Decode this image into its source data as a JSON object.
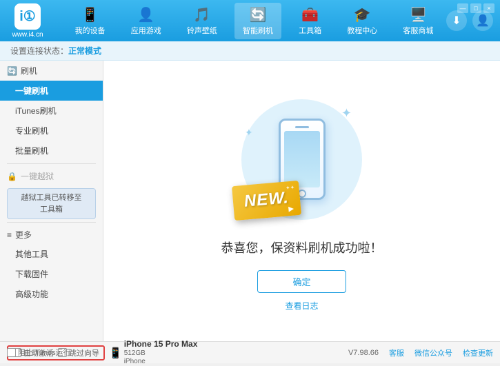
{
  "app": {
    "logo_text": "www.i4.cn",
    "logo_char": "i①"
  },
  "nav": {
    "items": [
      {
        "id": "my-devices",
        "label": "我的设备",
        "icon": "📱"
      },
      {
        "id": "apps-games",
        "label": "应用游戏",
        "icon": "👤"
      },
      {
        "id": "ringtones",
        "label": "铃声壁纸",
        "icon": "🎵"
      },
      {
        "id": "smart-flash",
        "label": "智能刷机",
        "icon": "🔄",
        "active": true
      },
      {
        "id": "toolbox",
        "label": "工具箱",
        "icon": "🧰"
      },
      {
        "id": "tutorials",
        "label": "教程中心",
        "icon": "🎓"
      },
      {
        "id": "service",
        "label": "客服商城",
        "icon": "🖥️"
      }
    ]
  },
  "statusbar": {
    "prefix": "设置连接状态：",
    "status": "正常模式"
  },
  "sidebar": {
    "section1_label": "刷机",
    "section1_icon": "🔄",
    "items": [
      {
        "id": "one-click-flash",
        "label": "一键刷机",
        "active": true
      },
      {
        "id": "itunes-flash",
        "label": "iTunes刷机"
      },
      {
        "id": "pro-flash",
        "label": "专业刷机"
      },
      {
        "id": "batch-flash",
        "label": "批量刷机"
      }
    ],
    "disabled_label": "一键越狱",
    "toolbox_label": "越狱工具已转移至\n工具箱",
    "more_label": "更多",
    "more_items": [
      {
        "id": "other-tools",
        "label": "其他工具"
      },
      {
        "id": "download-firmware",
        "label": "下载固件"
      },
      {
        "id": "advanced",
        "label": "高级功能"
      }
    ]
  },
  "main": {
    "new_badge": "NEW.",
    "success_text": "恭喜您，保资料刷机成功啦！",
    "confirm_button": "确定",
    "log_link": "查看日志"
  },
  "bottom": {
    "auto_activate_label": "自动激活",
    "auto_guide_label": "跳过向导",
    "device_icon": "📱",
    "device_name": "iPhone 15 Pro Max",
    "device_storage": "512GB",
    "device_type": "iPhone",
    "itunes_label": "阻止iTunes运行",
    "version": "V7.98.66",
    "links": [
      "客服",
      "微信公众号",
      "检查更新"
    ]
  },
  "window_controls": {
    "minimize": "—",
    "maximize": "□",
    "close": "×"
  }
}
